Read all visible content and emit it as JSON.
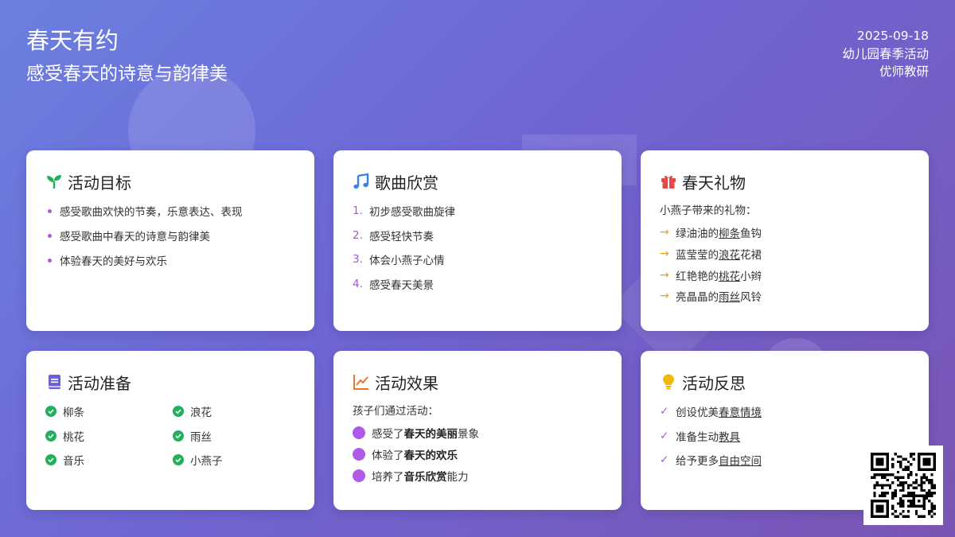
{
  "header": {
    "title": "春天有约",
    "subtitle": "感受春天的诗意与韵律美",
    "date": "2025-09-18",
    "activity": "幼儿园春季活动",
    "author": "优师教研"
  },
  "cards": {
    "goals": {
      "title": "活动目标",
      "icon": "sprout-icon",
      "items": [
        "感受歌曲欢快的节奏，乐意表达、表现",
        "感受歌曲中春天的诗意与韵律美",
        "体验春天的美好与欢乐"
      ]
    },
    "song": {
      "title": "歌曲欣赏",
      "icon": "music-note-icon",
      "items": [
        {
          "num": "1.",
          "text": "初步感受歌曲旋律"
        },
        {
          "num": "2.",
          "text": "感受轻快节奏"
        },
        {
          "num": "3.",
          "text": "体会小燕子心情"
        },
        {
          "num": "4.",
          "text": "感受春天美景"
        }
      ]
    },
    "gift": {
      "title": "春天礼物",
      "icon": "gift-icon",
      "intro": "小燕子带来的礼物：",
      "items": [
        {
          "pre": "绿油油的",
          "em": "柳条",
          "post": "鱼钩"
        },
        {
          "pre": "蓝莹莹的",
          "em": "浪花",
          "post": "花裙"
        },
        {
          "pre": "红艳艳的",
          "em": "桃花",
          "post": "小辫"
        },
        {
          "pre": "亮晶晶的",
          "em": "雨丝",
          "post": "风铃"
        }
      ]
    },
    "prep": {
      "title": "活动准备",
      "icon": "book-icon",
      "items": [
        "柳条",
        "浪花",
        "桃花",
        "雨丝",
        "音乐",
        "小燕子"
      ]
    },
    "effect": {
      "title": "活动效果",
      "icon": "chart-line-icon",
      "intro": "孩子们通过活动：",
      "items": [
        {
          "pre": "感受了",
          "em": "春天的美丽",
          "post": "景象"
        },
        {
          "pre": "体验了",
          "em": "春天的欢乐",
          "post": ""
        },
        {
          "pre": "培养了",
          "em": "音乐欣赏",
          "post": "能力"
        }
      ]
    },
    "reflect": {
      "title": "活动反思",
      "icon": "lightbulb-icon",
      "items": [
        {
          "pre": "创设优美",
          "em": "春意情境"
        },
        {
          "pre": "准备生动",
          "em": "教具"
        },
        {
          "pre": "给予更多",
          "em": "自由空间"
        }
      ]
    }
  },
  "colors": {
    "bg_start": "#6b7fe0",
    "bg_end": "#7a55b3",
    "accent_purple": "#a25ad6",
    "accent_green": "#22b05a",
    "accent_orange": "#e6a11a"
  }
}
